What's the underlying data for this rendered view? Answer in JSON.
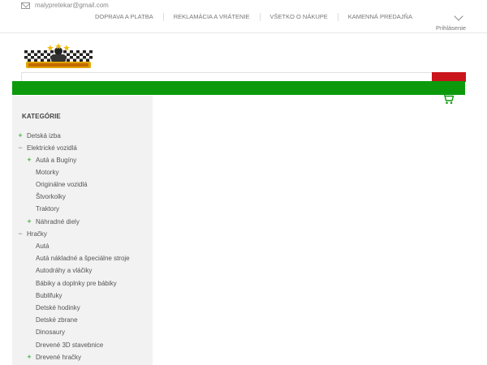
{
  "topbar": {
    "email": "malypretekar@gmail.com",
    "nav": [
      "DOPRAVA A PLATBA",
      "REKLAMÁCIA A VRÁTENIE",
      "VŠETKO O NÁKUPE",
      "KAMENNÁ PREDAJŇA"
    ],
    "login": "Prihlásenie"
  },
  "colors": {
    "accent_green": "#0c9a0c",
    "search_button": "#c9151b",
    "sidebar_bg": "#f2f2f2"
  },
  "search": {
    "value": ""
  },
  "sidebar": {
    "title": "KATEGÓRIE",
    "items": [
      {
        "label": "Detská izba",
        "sign": "+"
      },
      {
        "label": "Elektrické vozidlá",
        "sign": "−"
      },
      {
        "label": "Autá a Bugíny",
        "sign": "+"
      },
      {
        "label": "Motorky",
        "sign": ""
      },
      {
        "label": "Originálne vozidlá",
        "sign": ""
      },
      {
        "label": "Štvorkolky",
        "sign": ""
      },
      {
        "label": "Traktory",
        "sign": ""
      },
      {
        "label": "Náhradné diely",
        "sign": "+"
      },
      {
        "label": "Hračky",
        "sign": "−"
      },
      {
        "label": "Autá",
        "sign": ""
      },
      {
        "label": "Autá nákladné a špeciálne stroje",
        "sign": ""
      },
      {
        "label": "Autodráhy a vláčiky",
        "sign": ""
      },
      {
        "label": "Bábiky a doplnky pre bábiky",
        "sign": ""
      },
      {
        "label": "Bublifuky",
        "sign": ""
      },
      {
        "label": "Detské hodinky",
        "sign": ""
      },
      {
        "label": "Detské zbrane",
        "sign": ""
      },
      {
        "label": "Dinosaury",
        "sign": ""
      },
      {
        "label": "Drevené 3D stavebnice",
        "sign": ""
      },
      {
        "label": "Drevené hračky",
        "sign": "+"
      }
    ]
  }
}
